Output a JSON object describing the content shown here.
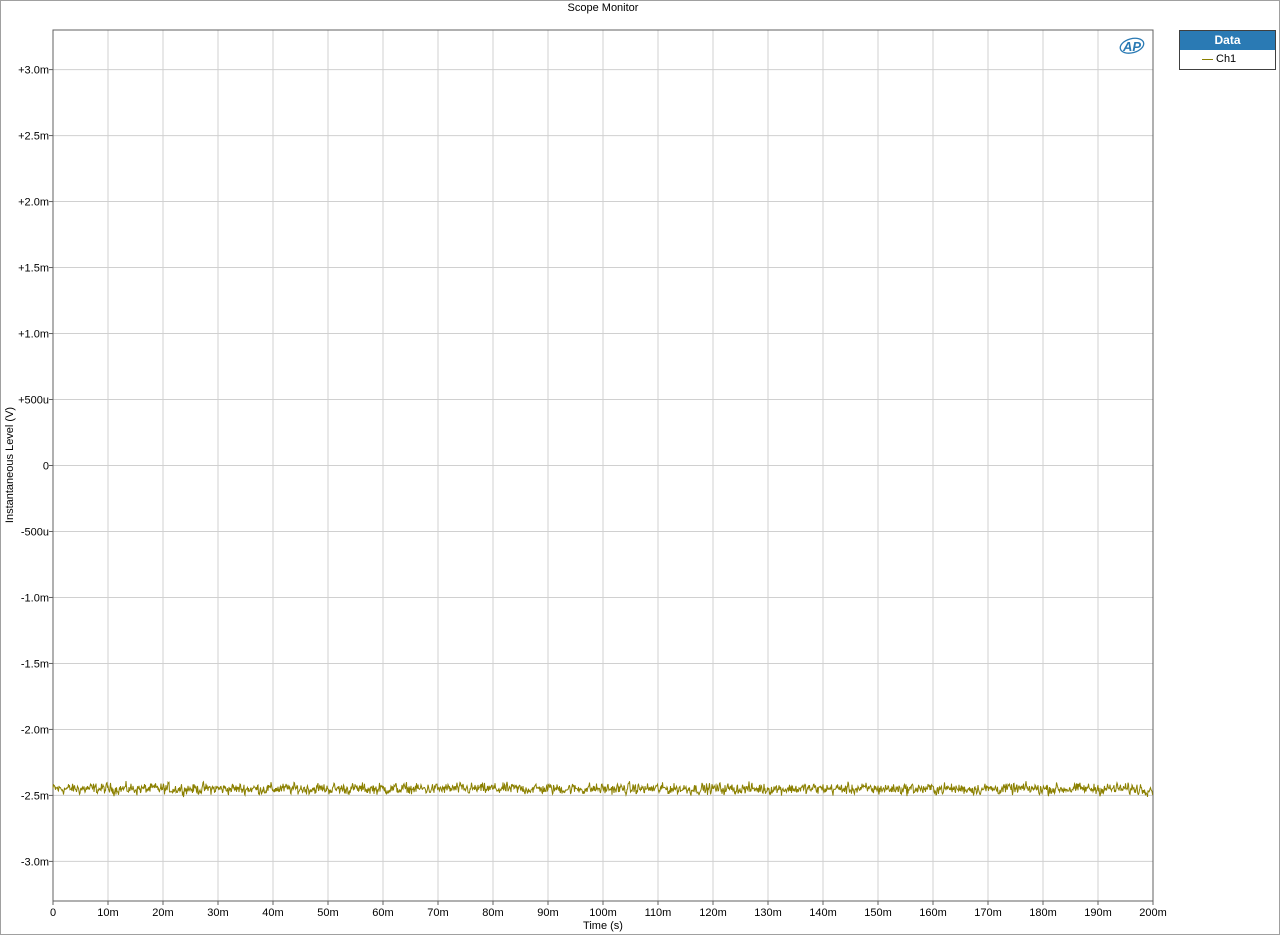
{
  "chart_data": {
    "type": "line",
    "title": "Scope Monitor",
    "xlabel": "Time (s)",
    "ylabel": "Instantaneous Level (V)",
    "xlim": [
      0,
      0.2
    ],
    "ylim": [
      -0.0033,
      0.0033
    ],
    "grid": true,
    "legend_placement": "top-right-outside",
    "legend_title": "Data",
    "x_ticks": [
      0,
      0.01,
      0.02,
      0.03,
      0.04,
      0.05,
      0.06,
      0.07,
      0.08,
      0.09,
      0.1,
      0.11,
      0.12,
      0.13,
      0.14,
      0.15,
      0.16,
      0.17,
      0.18,
      0.19,
      0.2
    ],
    "x_tick_labels": [
      "0",
      "10m",
      "20m",
      "30m",
      "40m",
      "50m",
      "60m",
      "70m",
      "80m",
      "90m",
      "100m",
      "110m",
      "120m",
      "130m",
      "140m",
      "150m",
      "160m",
      "170m",
      "180m",
      "190m",
      "200m"
    ],
    "y_ticks": [
      0.003,
      0.0025,
      0.002,
      0.0015,
      0.001,
      0.0005,
      0,
      -0.0005,
      -0.001,
      -0.0015,
      -0.002,
      -0.0025,
      -0.003
    ],
    "y_tick_labels": [
      "+3.0m",
      "+2.5m",
      "+2.0m",
      "+1.5m",
      "+1.0m",
      "+500u",
      "0",
      "-500u",
      "-1.0m",
      "-1.5m",
      "-2.0m",
      "-2.5m",
      "-3.0m"
    ],
    "series": [
      {
        "name": "Ch1",
        "color": "#8b8000",
        "x_start": 0,
        "x_end": 0.2,
        "mean": -0.00245,
        "noise_peak": 9e-05,
        "note_shape": "noise"
      }
    ]
  },
  "logo_text": "AP",
  "colors": {
    "grid": "#d0d0d0",
    "legend_header": "#2a7ab4",
    "logo": "#2a7ab4"
  }
}
